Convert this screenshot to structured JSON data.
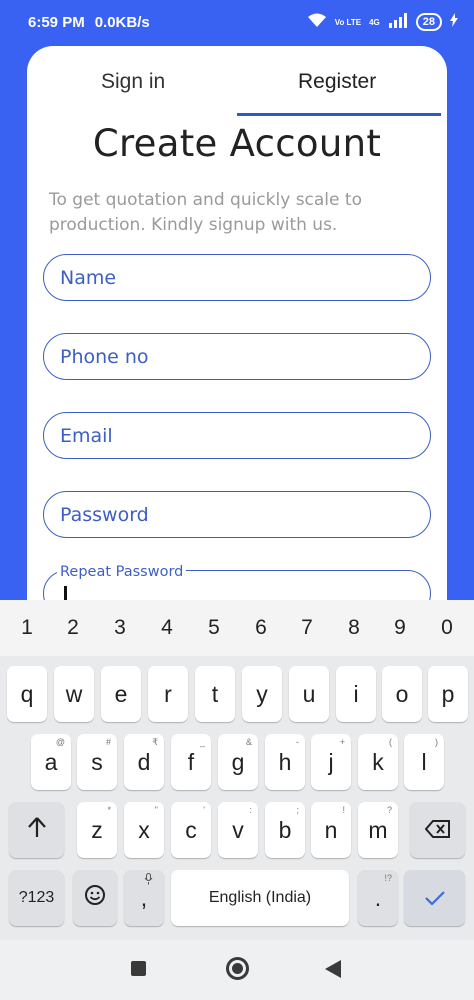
{
  "status": {
    "time": "6:59 PM",
    "speed": "0.0KB/s",
    "network_top": "4G",
    "volte": "Vo LTE",
    "battery": "28"
  },
  "tabs": {
    "signin": "Sign in",
    "register": "Register"
  },
  "form": {
    "title": "Create Account",
    "subtitle": "To get quotation and quickly scale to production. Kindly signup with us.",
    "name_placeholder": "Name",
    "phone_placeholder": "Phone no",
    "email_placeholder": "Email",
    "password_placeholder": "Password",
    "repeat_label": "Repeat Password"
  },
  "keyboard": {
    "numbers": [
      "1",
      "2",
      "3",
      "4",
      "5",
      "6",
      "7",
      "8",
      "9",
      "0"
    ],
    "row1": [
      "q",
      "w",
      "e",
      "r",
      "t",
      "y",
      "u",
      "i",
      "o",
      "p"
    ],
    "row2": [
      "a",
      "s",
      "d",
      "f",
      "g",
      "h",
      "j",
      "k",
      "l"
    ],
    "row2_sup": [
      "@",
      "#",
      "₹",
      "_",
      "&",
      "-",
      "+",
      "(",
      ")"
    ],
    "row3": [
      "z",
      "x",
      "c",
      "v",
      "b",
      "n",
      "m"
    ],
    "row3_sup": [
      "*",
      "\"",
      "'",
      ":",
      ";",
      "!",
      "?"
    ],
    "symbols_label": "?123",
    "comma": ",",
    "space_label": "English (India)",
    "period": ".",
    "period_sup": "!?"
  },
  "colors": {
    "accent": "#3a62f2",
    "field_border": "#3d5fc4"
  }
}
